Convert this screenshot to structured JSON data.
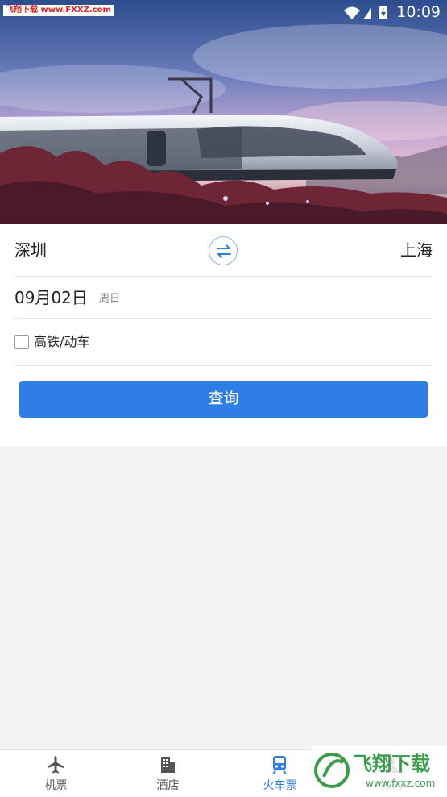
{
  "status_bar": {
    "time": "10:09",
    "watermark": "飞翔下载 www.FXXZ.com"
  },
  "banner": {
    "image": "high-speed-train"
  },
  "route": {
    "from": "深圳",
    "to": "上海"
  },
  "date": {
    "value": "09月02日",
    "weekday": "周日"
  },
  "filter": {
    "label": "高铁/动车",
    "checked": false
  },
  "search_button": "查询",
  "tabs": [
    {
      "label": "机票",
      "icon": "plane-icon",
      "active": false
    },
    {
      "label": "酒店",
      "icon": "building-icon",
      "active": false
    },
    {
      "label": "火车票",
      "icon": "train-icon",
      "active": true
    },
    {
      "label": "我的",
      "icon": "user-icon",
      "active": false
    }
  ],
  "bottom_watermark": {
    "text": "飞翔下载",
    "url": "www.fxxz.com"
  },
  "colors": {
    "accent": "#2f7ee6",
    "background": "#f4f4f4"
  }
}
